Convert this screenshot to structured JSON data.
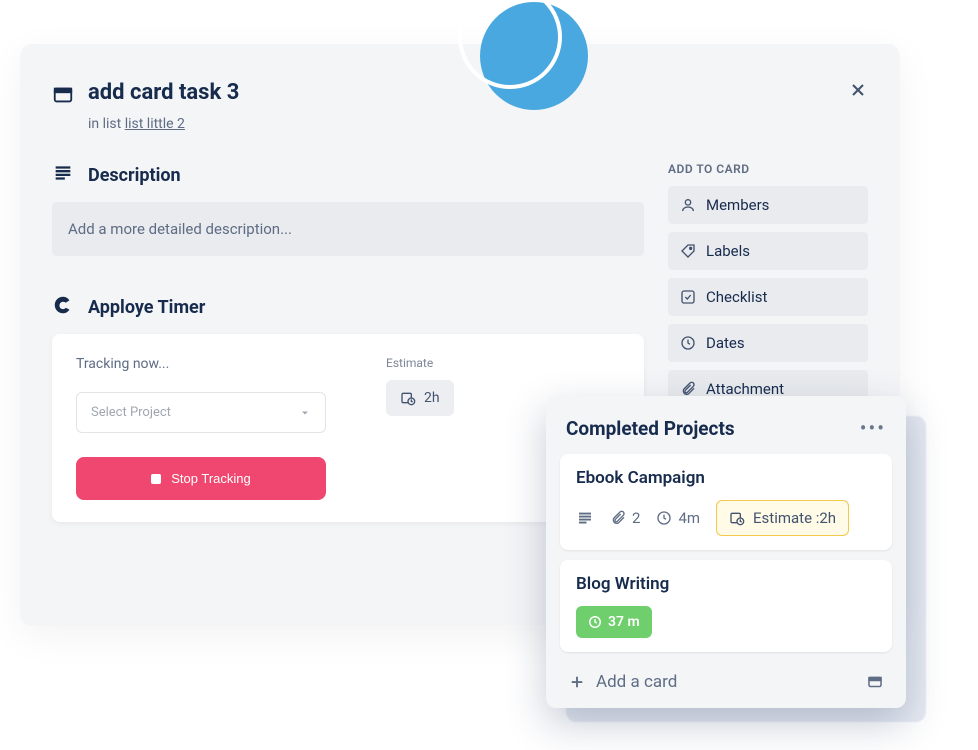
{
  "decor": {},
  "card": {
    "title": "add card task 3",
    "in_list_prefix": "in list ",
    "list_name": "list little 2"
  },
  "description": {
    "heading": "Description",
    "placeholder": "Add a more detailed description..."
  },
  "sidebar": {
    "heading": "ADD TO CARD",
    "items": [
      {
        "label": "Members"
      },
      {
        "label": "Labels"
      },
      {
        "label": "Checklist"
      },
      {
        "label": "Dates"
      },
      {
        "label": "Attachment"
      }
    ]
  },
  "timer": {
    "heading": "Apploye Timer",
    "tracking_label": "Tracking now...",
    "select_placeholder": "Select Project",
    "stop_label": "Stop Tracking",
    "estimate_label": "Estimate",
    "estimate_value": "2h"
  },
  "list": {
    "title": "Completed Projects",
    "cards": [
      {
        "title": "Ebook Campaign",
        "attachments": "2",
        "time": "4m",
        "estimate_label": "Estimate :2h"
      },
      {
        "title": "Blog Writing",
        "time": "37 m"
      }
    ],
    "add_label": "Add a card"
  }
}
